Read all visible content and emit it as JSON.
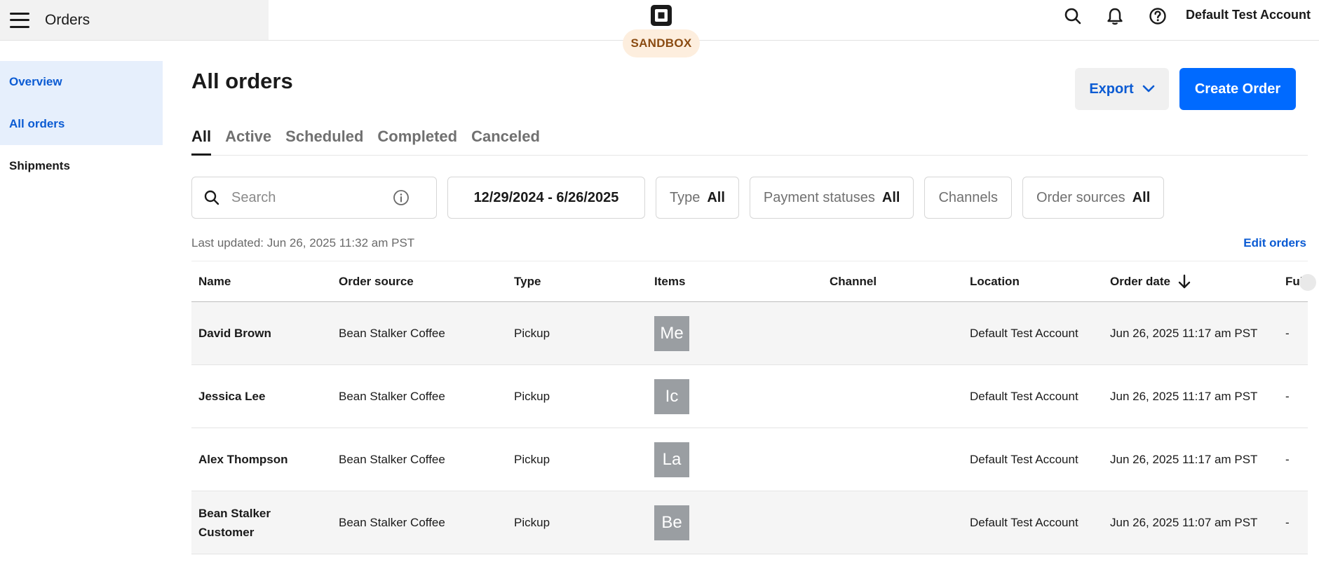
{
  "header": {
    "title": "Orders",
    "sandbox_label": "SANDBOX",
    "account_name": "Default Test Account"
  },
  "sidebar": {
    "items": [
      {
        "label": "Overview"
      },
      {
        "label": "All orders"
      },
      {
        "label": "Shipments"
      }
    ]
  },
  "main": {
    "title": "All orders",
    "export_label": "Export",
    "create_label": "Create Order",
    "tabs": [
      {
        "label": "All"
      },
      {
        "label": "Active"
      },
      {
        "label": "Scheduled"
      },
      {
        "label": "Completed"
      },
      {
        "label": "Canceled"
      }
    ],
    "filters": {
      "search_placeholder": "Search",
      "date_range": "12/29/2024 - 6/26/2025",
      "type_label": "Type",
      "type_value": "All",
      "payment_label": "Payment statuses",
      "payment_value": "All",
      "channels_label": "Channels",
      "sources_label": "Order sources",
      "sources_value": "All"
    },
    "last_updated": "Last updated: Jun 26, 2025 11:32 am PST",
    "edit_orders": "Edit orders"
  },
  "table": {
    "columns": [
      "Name",
      "Order source",
      "Type",
      "Items",
      "Channel",
      "Location",
      "Order date",
      "Fulf"
    ],
    "rows": [
      {
        "name": "David Brown",
        "source": "Bean Stalker Coffee",
        "type": "Pickup",
        "item": "Me",
        "channel": "",
        "location": "Default Test Account",
        "date": "Jun 26, 2025 11:17 am PST",
        "fulfillment": "-"
      },
      {
        "name": "Jessica Lee",
        "source": "Bean Stalker Coffee",
        "type": "Pickup",
        "item": "Ic",
        "channel": "",
        "location": "Default Test Account",
        "date": "Jun 26, 2025 11:17 am PST",
        "fulfillment": "-"
      },
      {
        "name": "Alex Thompson",
        "source": "Bean Stalker Coffee",
        "type": "Pickup",
        "item": "La",
        "channel": "",
        "location": "Default Test Account",
        "date": "Jun 26, 2025 11:17 am PST",
        "fulfillment": "-"
      },
      {
        "name": "Bean Stalker Customer",
        "source": "Bean Stalker Coffee",
        "type": "Pickup",
        "item": "Be",
        "channel": "",
        "location": "Default Test Account",
        "date": "Jun 26, 2025 11:07 am PST",
        "fulfillment": "-"
      }
    ]
  },
  "colors": {
    "accent": "#006aff",
    "link": "#0b5bd3",
    "sidebar_active_bg": "#e6effc",
    "sandbox_bg": "#fdeede",
    "sandbox_text": "#8a4b12",
    "item_thumb": "#9a9ea2"
  },
  "icons": [
    "menu-icon",
    "square-logo-icon",
    "search-icon",
    "bell-icon",
    "help-icon",
    "chevron-down-icon",
    "info-icon",
    "arrow-down-icon"
  ]
}
